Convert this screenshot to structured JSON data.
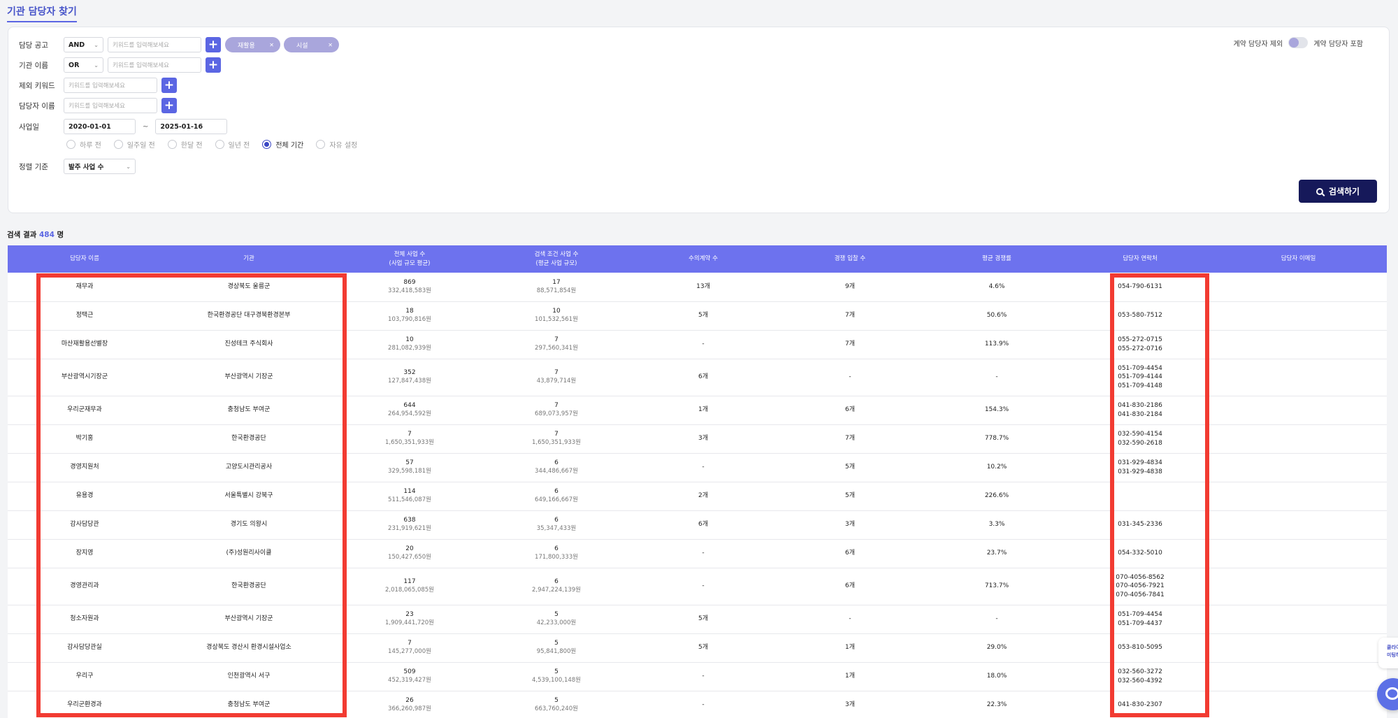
{
  "page": {
    "title": "기관 담당자 찾기"
  },
  "filters": {
    "notice_label": "담당 공고",
    "notice_op": "AND",
    "notice_placeholder": "키워드를 입력해보세요",
    "chips": [
      {
        "label": "재활용"
      },
      {
        "label": "시설"
      }
    ],
    "agency_label": "기관 이름",
    "agency_op": "OR",
    "agency_placeholder": "키워드를 입력해보세요",
    "exclude_label": "제외 키워드",
    "exclude_placeholder": "키워드를 입력해보세요",
    "person_label": "담당자 이름",
    "person_placeholder": "키워드를 입력해보세요",
    "date_label": "사업일",
    "date_from": "2020-01-01",
    "date_sep": "~",
    "date_to": "2025-01-16",
    "periods": [
      "하루 전",
      "일주일 전",
      "한달 전",
      "일년 전",
      "전체 기간",
      "자유 설정"
    ],
    "period_selected": "전체 기간",
    "sort_label": "정렬 기준",
    "sort_value": "발주 사업 수",
    "toggle_left": "계약 담당자 제외",
    "toggle_right": "계약 담당자 포함",
    "search_button": "검색하기"
  },
  "results": {
    "prefix": "검색 결과",
    "count": "484",
    "suffix": "명",
    "headers": {
      "name": "담당자 이름",
      "org": "기관",
      "total_a": "전체 사업 수",
      "total_b": "(사업 규모 평균)",
      "match_a": "검색 조건 사업 수",
      "match_b": "(평균 사업 규모)",
      "private_contract": "수의계약 수",
      "bids": "경쟁 입찰 수",
      "avg_rate": "평균 경쟁률",
      "phone": "담당자 연락처",
      "email": "담당자 이메일"
    },
    "rows": [
      {
        "name": "재무과",
        "org": "경상북도 울릉군",
        "total": "869",
        "total_avg": "332,418,583원",
        "match": "17",
        "match_avg": "88,571,854원",
        "private_contract": "13개",
        "bids": "9개",
        "avg_rate": "4.6%",
        "phones": [
          "054-790-6131"
        ],
        "email": ""
      },
      {
        "name": "정택근",
        "org": "한국환경공단 대구경북환경본부",
        "total": "18",
        "total_avg": "103,790,816원",
        "match": "10",
        "match_avg": "101,532,561원",
        "private_contract": "5개",
        "bids": "7개",
        "avg_rate": "50.6%",
        "phones": [
          "053-580-7512"
        ],
        "email": ""
      },
      {
        "name": "마산재활용선별장",
        "org": "진성테크 주식회사",
        "total": "10",
        "total_avg": "281,082,939원",
        "match": "7",
        "match_avg": "297,560,341원",
        "private_contract": "-",
        "bids": "7개",
        "avg_rate": "113.9%",
        "phones": [
          "055-272-0715",
          "055-272-0716"
        ],
        "email": ""
      },
      {
        "name": "부산광역시기장군",
        "org": "부산광역시 기장군",
        "total": "352",
        "total_avg": "127,847,438원",
        "match": "7",
        "match_avg": "43,879,714원",
        "private_contract": "6개",
        "bids": "-",
        "avg_rate": "-",
        "phones": [
          "051-709-4454",
          "051-709-4144",
          "051-709-4148"
        ],
        "email": ""
      },
      {
        "name": "우리군재무과",
        "org": "충청남도 부여군",
        "total": "644",
        "total_avg": "264,954,592원",
        "match": "7",
        "match_avg": "689,073,957원",
        "private_contract": "1개",
        "bids": "6개",
        "avg_rate": "154.3%",
        "phones": [
          "041-830-2186",
          "041-830-2184"
        ],
        "email": ""
      },
      {
        "name": "박기홍",
        "org": "한국환경공단",
        "total": "7",
        "total_avg": "1,650,351,933원",
        "match": "7",
        "match_avg": "1,650,351,933원",
        "private_contract": "3개",
        "bids": "7개",
        "avg_rate": "778.7%",
        "phones": [
          "032-590-4154",
          "032-590-2618"
        ],
        "email": ""
      },
      {
        "name": "경영지원처",
        "org": "고양도시관리공사",
        "total": "57",
        "total_avg": "329,598,181원",
        "match": "6",
        "match_avg": "344,486,667원",
        "private_contract": "-",
        "bids": "5개",
        "avg_rate": "10.2%",
        "phones": [
          "031-929-4834",
          "031-929-4838"
        ],
        "email": ""
      },
      {
        "name": "유용경",
        "org": "서울특별시 강북구",
        "total": "114",
        "total_avg": "511,546,087원",
        "match": "6",
        "match_avg": "649,166,667원",
        "private_contract": "2개",
        "bids": "5개",
        "avg_rate": "226.6%",
        "phones": [],
        "email": ""
      },
      {
        "name": "감사담당관",
        "org": "경기도 의왕시",
        "total": "638",
        "total_avg": "231,919,621원",
        "match": "6",
        "match_avg": "35,347,433원",
        "private_contract": "6개",
        "bids": "3개",
        "avg_rate": "3.3%",
        "phones": [
          "031-345-2336"
        ],
        "email": ""
      },
      {
        "name": "장지영",
        "org": "(주)성원리사이클",
        "total": "20",
        "total_avg": "150,427,650원",
        "match": "6",
        "match_avg": "171,800,333원",
        "private_contract": "-",
        "bids": "6개",
        "avg_rate": "23.7%",
        "phones": [
          "054-332-5010"
        ],
        "email": ""
      },
      {
        "name": "경영관리과",
        "org": "한국환경공단",
        "total": "117",
        "total_avg": "2,018,065,085원",
        "match": "6",
        "match_avg": "2,947,224,139원",
        "private_contract": "-",
        "bids": "6개",
        "avg_rate": "713.7%",
        "phones": [
          "070-4056-8562",
          "070-4056-7921",
          "070-4056-7841"
        ],
        "email": ""
      },
      {
        "name": "청소자원과",
        "org": "부산광역시 기장군",
        "total": "23",
        "total_avg": "1,909,441,720원",
        "match": "5",
        "match_avg": "42,233,000원",
        "private_contract": "5개",
        "bids": "-",
        "avg_rate": "-",
        "phones": [
          "051-709-4454",
          "051-709-4437"
        ],
        "email": ""
      },
      {
        "name": "감사담당관실",
        "org": "경상북도 경산시 환경시설사업소",
        "total": "7",
        "total_avg": "145,277,000원",
        "match": "5",
        "match_avg": "95,841,800원",
        "private_contract": "5개",
        "bids": "1개",
        "avg_rate": "29.0%",
        "phones": [
          "053-810-5095"
        ],
        "email": ""
      },
      {
        "name": "우리구",
        "org": "인천광역시 서구",
        "total": "509",
        "total_avg": "452,319,427원",
        "match": "5",
        "match_avg": "4,539,100,148원",
        "private_contract": "-",
        "bids": "1개",
        "avg_rate": "18.0%",
        "phones": [
          "032-560-3272",
          "032-560-4392"
        ],
        "email": ""
      },
      {
        "name": "우리군환경과",
        "org": "충청남도 부여군",
        "total": "26",
        "total_avg": "366,260,987원",
        "match": "5",
        "match_avg": "663,760,240원",
        "private_contract": "-",
        "bids": "3개",
        "avg_rate": "22.3%",
        "phones": [
          "041-830-2307"
        ],
        "email": ""
      }
    ]
  },
  "widget": {
    "line1": "클라이",
    "line2": "미팅하"
  },
  "colors": {
    "primary": "#5b66e3",
    "header_bg": "#6d72ee",
    "search_btn": "#16195a",
    "chip": "#a9a6dc",
    "highlight": "#f23b32"
  }
}
